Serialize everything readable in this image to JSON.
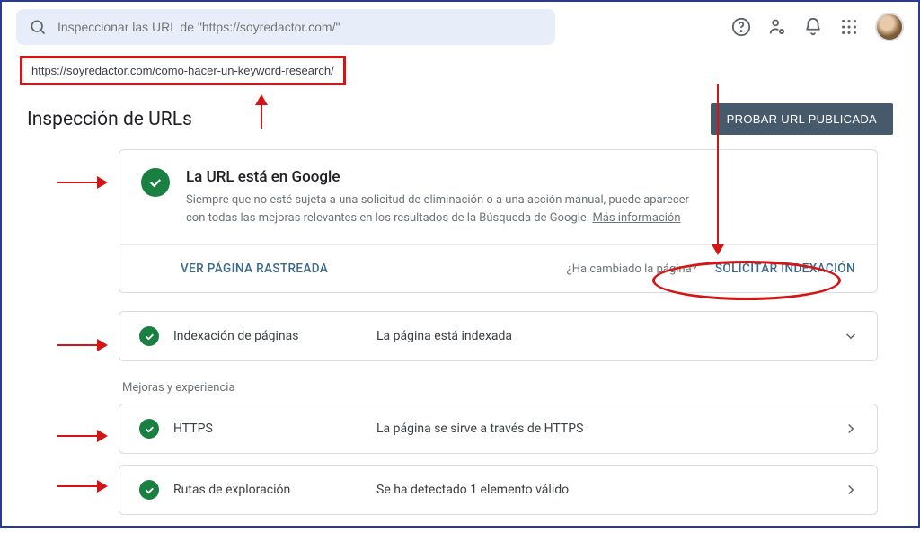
{
  "topbar": {
    "search_placeholder": "Inspeccionar las URL de \"https://soyredactor.com/\""
  },
  "url_inspected": "https://soyredactor.com/como-hacer-un-keyword-research/",
  "page_title": "Inspección de URLs",
  "test_live_label": "PROBAR URL PUBLICADA",
  "main_card": {
    "title": "La URL está en Google",
    "desc_prefix": "Siempre que no esté sujeta a una solicitud de eliminación o a una acción manual, puede aparecer con todas las mejoras relevantes en los resultados de la Búsqueda de Google. ",
    "more_info": "Más información",
    "view_crawled": "VER PÁGINA RASTREADA",
    "changed_q": "¿Ha cambiado la página?",
    "request_index": "SOLICITAR INDEXACIÓN"
  },
  "rows": {
    "index_label": "Indexación de páginas",
    "index_status": "La página está indexada",
    "section_enhancements": "Mejoras y experiencia",
    "https_label": "HTTPS",
    "https_status": "La página se sirve a través de HTTPS",
    "breadcrumbs_label": "Rutas de exploración",
    "breadcrumbs_status": "Se ha detectado 1 elemento válido"
  }
}
